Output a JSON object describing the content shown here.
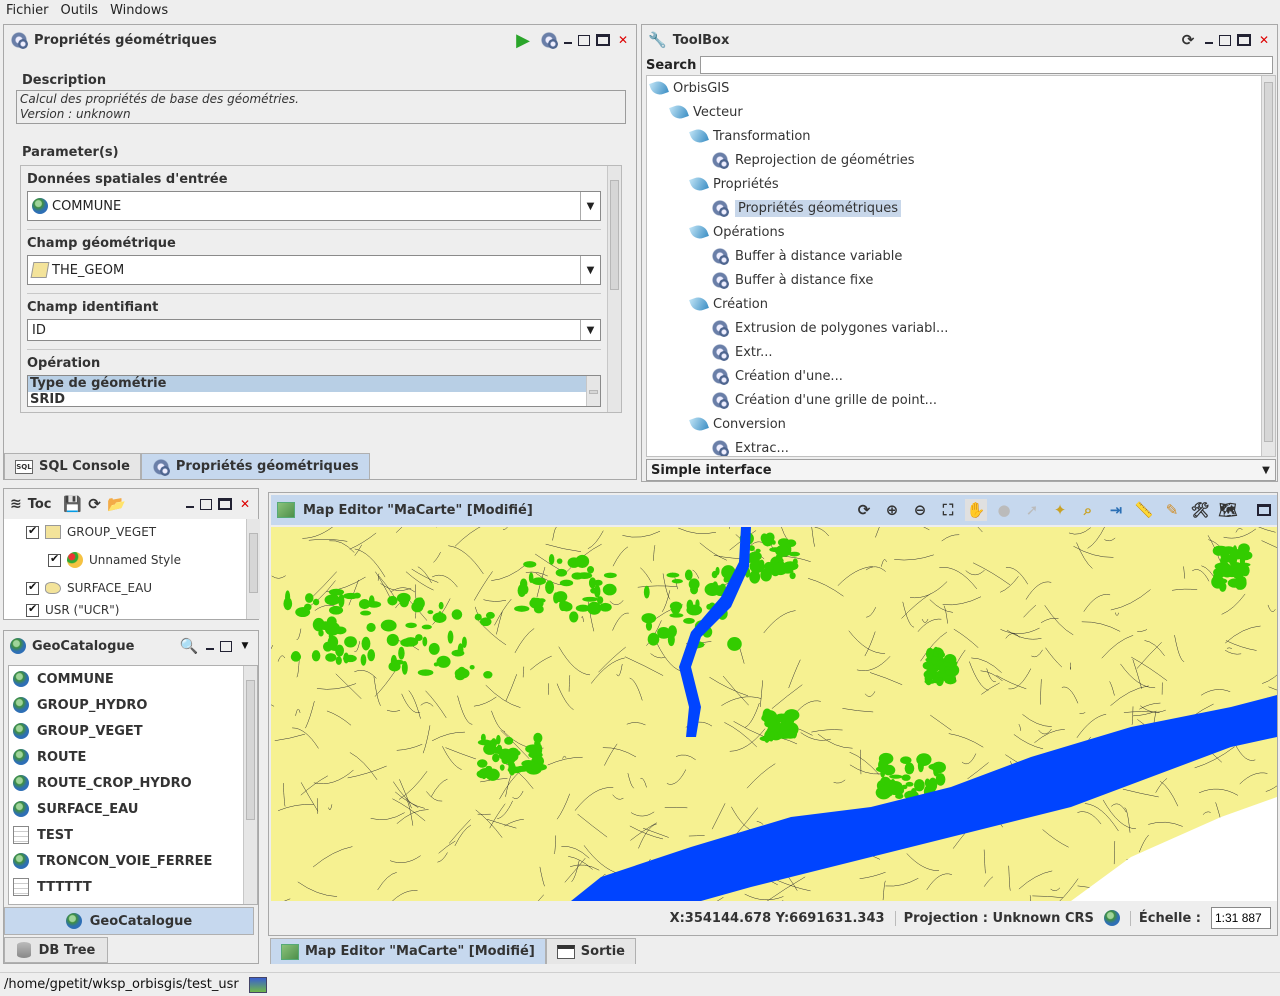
{
  "menubar": {
    "items": [
      "Fichier",
      "Outils",
      "Windows"
    ]
  },
  "props_panel": {
    "title": "Propriétés géométriques",
    "description_legend": "Description",
    "description_lines": [
      "Calcul des propriétés de base des géométries.",
      "Version : unknown"
    ],
    "parameters_legend": "Parameter(s)",
    "input_label": "Données spatiales d'entrée",
    "input_value": "COMMUNE",
    "geom_label": "Champ géométrique",
    "geom_value": "THE_GEOM",
    "id_label": "Champ identifiant",
    "id_value": "ID",
    "operation_label": "Opération",
    "operation_options": [
      "Type de géométrie",
      "SRID"
    ],
    "tabs": [
      "SQL Console",
      "Propriétés géométriques"
    ]
  },
  "toolbox": {
    "title": "ToolBox",
    "search_label": "Search",
    "search_value": "",
    "tree": [
      {
        "label": "OrbisGIS",
        "level": 0,
        "kind": "folder"
      },
      {
        "label": "Vecteur",
        "level": 1,
        "kind": "folder"
      },
      {
        "label": "Transformation",
        "level": 2,
        "kind": "folder"
      },
      {
        "label": "Reprojection de géométries",
        "level": 3,
        "kind": "tool"
      },
      {
        "label": "Propriétés",
        "level": 2,
        "kind": "folder"
      },
      {
        "label": "Propriétés géométriques",
        "level": 3,
        "kind": "tool",
        "selected": true
      },
      {
        "label": "Opérations",
        "level": 2,
        "kind": "folder"
      },
      {
        "label": "Buffer à distance variable",
        "level": 3,
        "kind": "tool"
      },
      {
        "label": "Buffer à distance fixe",
        "level": 3,
        "kind": "tool"
      },
      {
        "label": "Création",
        "level": 2,
        "kind": "folder"
      },
      {
        "label": "Extrusion de polygones variabl...",
        "level": 3,
        "kind": "tool"
      },
      {
        "label": "Extr...",
        "level": 3,
        "kind": "tool"
      },
      {
        "label": "Création d'une...",
        "level": 3,
        "kind": "tool"
      },
      {
        "label": "Création d'une grille de point...",
        "level": 3,
        "kind": "tool"
      },
      {
        "label": "Conversion",
        "level": 2,
        "kind": "folder"
      },
      {
        "label": "Extrac...",
        "level": 3,
        "kind": "tool"
      }
    ],
    "footer_label": "Simple interface"
  },
  "toc": {
    "title": "Toc",
    "rows": [
      "GROUP_VEGET",
      "Unnamed Style",
      "SURFACE_EAU",
      "USR (\"UCR\")"
    ]
  },
  "geocatalogue": {
    "title": "GeoCatalogue",
    "items": [
      {
        "label": "COMMUNE",
        "icon": "globe"
      },
      {
        "label": "GROUP_HYDRO",
        "icon": "globe"
      },
      {
        "label": "GROUP_VEGET",
        "icon": "globe"
      },
      {
        "label": "ROUTE",
        "icon": "globe"
      },
      {
        "label": "ROUTE_CROP_HYDRO",
        "icon": "globe"
      },
      {
        "label": "SURFACE_EAU",
        "icon": "globe"
      },
      {
        "label": "TEST",
        "icon": "table"
      },
      {
        "label": "TRONCON_VOIE_FERREE",
        "icon": "globe"
      },
      {
        "label": "TTTTTT",
        "icon": "table"
      }
    ],
    "tab_active": "GeoCatalogue",
    "tab_other": "DB Tree"
  },
  "map_editor": {
    "title": "Map Editor \"MaCarte\" [Modifié]",
    "coords": "X:354144.678 Y:6691631.343",
    "projection": "Projection : Unknown CRS",
    "scale_label": "Échelle :",
    "scale_value": "1:31 887",
    "tabs": [
      "Map Editor \"MaCarte\" [Modifié]",
      "Sortie"
    ],
    "colors": {
      "land": "#f6f191",
      "vegetation": "#33cc00",
      "water": "#0044ff"
    }
  },
  "status_bar": {
    "path": "/home/gpetit/wksp_orbisgis/test_usr"
  }
}
